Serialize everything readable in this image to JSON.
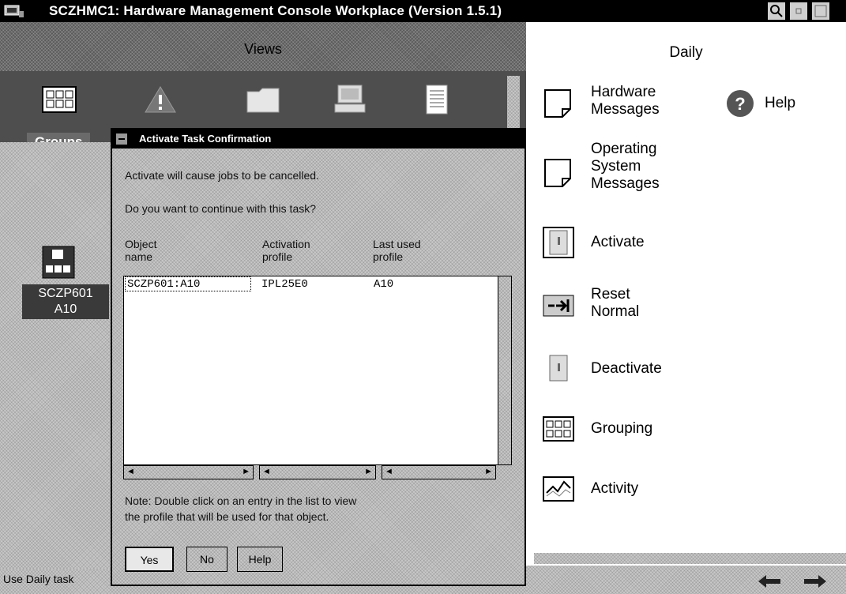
{
  "window": {
    "title": "SCZHMC1: Hardware Management Console Workplace (Version 1.5.1)",
    "icon": "console-icon",
    "buttons": [
      "help-icon",
      "minimize-icon",
      "maximize-icon"
    ]
  },
  "views": {
    "title": "Views",
    "icons": [
      "groups-icon",
      "exceptions-icon",
      "active-tasks-icon",
      "console-actions-icon",
      "task-list-icon"
    ],
    "selected_label": "Groups"
  },
  "workarea": {
    "object_label_line1": "SCZP601",
    "object_label_line2": "A10"
  },
  "status": {
    "text": "Use Daily task"
  },
  "dialog": {
    "title": "Activate Task Confirmation",
    "message": "Activate will cause jobs to be cancelled.",
    "question": "Do you want to continue with this task?",
    "columns": [
      {
        "line1": "Object",
        "line2": "name"
      },
      {
        "line1": "Activation",
        "line2": "profile"
      },
      {
        "line1": "Last used",
        "line2": "profile"
      }
    ],
    "rows": [
      {
        "object": "SCZP601:A10",
        "activation": "IPL25E0",
        "last_used": "A10"
      }
    ],
    "note_line1": "Note: Double click on an entry in the list to view",
    "note_line2": "the profile that will be used for that object.",
    "buttons": {
      "yes": "Yes",
      "no": "No",
      "help": "Help"
    }
  },
  "daily": {
    "title": "Daily",
    "tasks": [
      {
        "line1": "Hardware",
        "line2": "Messages",
        "icon": "messages-icon"
      },
      {
        "line1": "Operating",
        "line2": "System",
        "line3": "Messages",
        "icon": "messages-icon"
      },
      {
        "line1": "Activate",
        "icon": "activate-icon"
      },
      {
        "line1": "Reset",
        "line2": "Normal",
        "icon": "reset-icon"
      },
      {
        "line1": "Deactivate",
        "icon": "deactivate-icon"
      },
      {
        "line1": "Grouping",
        "icon": "grouping-icon"
      },
      {
        "line1": "Activity",
        "icon": "activity-icon"
      }
    ],
    "help": {
      "label": "Help",
      "icon": "help-icon"
    }
  }
}
